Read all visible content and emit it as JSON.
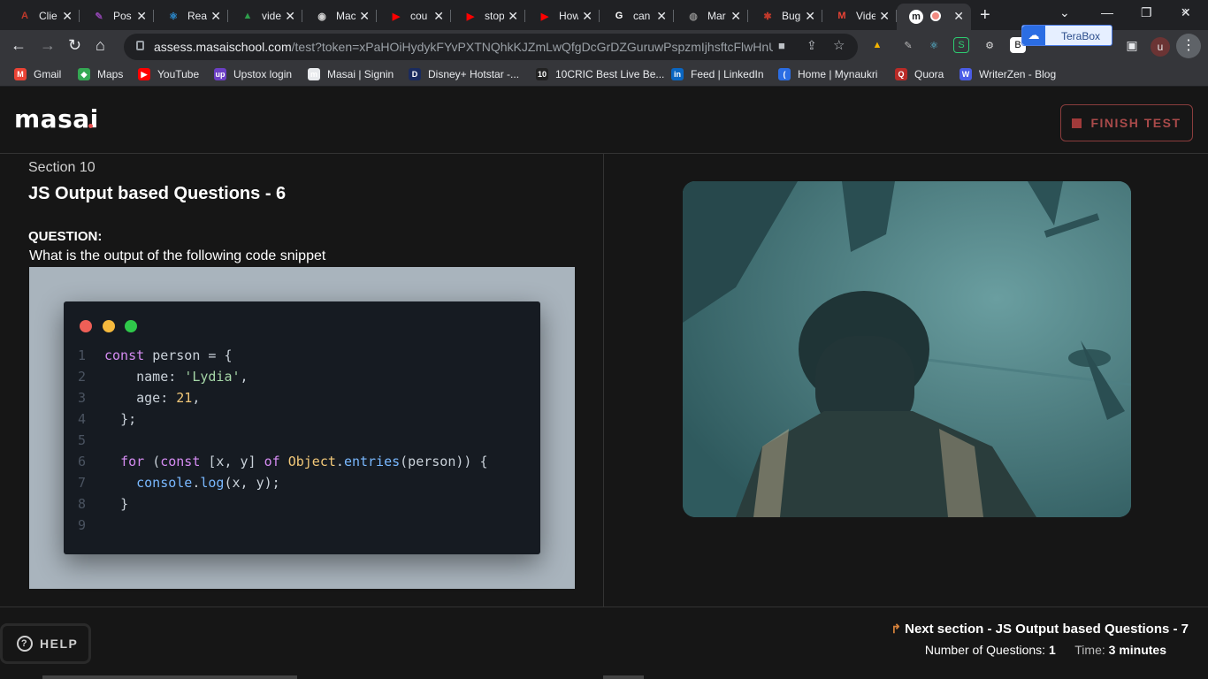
{
  "browser": {
    "tabs": [
      {
        "label": "Clie",
        "icon": "acrobat-icon",
        "color": "#c0392b",
        "glyph": "A"
      },
      {
        "label": "Pos",
        "icon": "pen-icon",
        "color": "#8e44ad",
        "glyph": "✎"
      },
      {
        "label": "Rea",
        "icon": "react-icon",
        "color": "#2b8fd6",
        "glyph": "⚛"
      },
      {
        "label": "vide",
        "icon": "drive-icon",
        "color": "#2e9e4b",
        "glyph": "▲"
      },
      {
        "label": "Mac",
        "icon": "ball-icon",
        "color": "#d0d0d0",
        "glyph": "◉"
      },
      {
        "label": "cou",
        "icon": "youtube-icon",
        "color": "#ff0000",
        "glyph": "▶"
      },
      {
        "label": "stop",
        "icon": "youtube-icon",
        "color": "#ff0000",
        "glyph": "▶"
      },
      {
        "label": "How",
        "icon": "youtube-icon",
        "color": "#ff0000",
        "glyph": "▶"
      },
      {
        "label": "can",
        "icon": "google-icon",
        "color": "#ffffff",
        "glyph": "G"
      },
      {
        "label": "Mar",
        "icon": "globe-icon",
        "color": "#888888",
        "glyph": "◍"
      },
      {
        "label": "Bug",
        "icon": "bug-icon",
        "color": "#c0392b",
        "glyph": "✱"
      },
      {
        "label": "Vide",
        "icon": "gmail-icon",
        "color": "#ea4335",
        "glyph": "M"
      },
      {
        "label": "",
        "icon": "masai-icon",
        "color": "#ffffff",
        "glyph": "m",
        "active": true
      }
    ],
    "close_glyph": "✕",
    "new_tab_glyph": "+",
    "url_host": "assess.masaischool.com",
    "url_path": "/test?token=xPaHOiHydykFYvPXTNQhkKJZmLwQfgDcGrDZGuruwPspzmIjhsftcFlwHnUf...",
    "extension_label": "TeraBox",
    "profile_initial": "u",
    "bookmarks": [
      {
        "label": "Gmail",
        "icon": "gmail-icon",
        "color": "#ea4335",
        "glyph": "M"
      },
      {
        "label": "Maps",
        "icon": "maps-icon",
        "color": "#34a853",
        "glyph": "◆"
      },
      {
        "label": "YouTube",
        "icon": "youtube-icon",
        "color": "#ff0000",
        "glyph": "▶"
      },
      {
        "label": "Upstox login",
        "icon": "upstox-icon",
        "color": "#6c3fc5",
        "glyph": "up"
      },
      {
        "label": "Masai | Signin",
        "icon": "masai-icon",
        "color": "#e8eaed",
        "glyph": "m"
      },
      {
        "label": "Disney+ Hotstar -...",
        "icon": "hotstar-icon",
        "color": "#1a2b5e",
        "glyph": "D"
      },
      {
        "label": "10CRIC Best Live Be...",
        "icon": "cric-icon",
        "color": "#222222",
        "glyph": "10"
      },
      {
        "label": "Feed | LinkedIn",
        "icon": "linkedin-icon",
        "color": "#0a66c2",
        "glyph": "in"
      },
      {
        "label": "Home | Mynaukri",
        "icon": "naukri-icon",
        "color": "#2b6de3",
        "glyph": "("
      },
      {
        "label": "Quora",
        "icon": "quora-icon",
        "color": "#b92b27",
        "glyph": "Q"
      },
      {
        "label": "WriterZen - Blog",
        "icon": "writerzen-icon",
        "color": "#4a5ce6",
        "glyph": "W"
      }
    ]
  },
  "header": {
    "logo": "masai",
    "finish_label": "FINISH TEST"
  },
  "question": {
    "section": "Section 10",
    "title": "JS Output based Questions - 6",
    "label": "QUESTION:",
    "text": "What is the output of the following code snippet"
  },
  "code": {
    "line_numbers": [
      "1",
      "2",
      "3",
      "4",
      "5",
      "6",
      "7",
      "8",
      "9"
    ]
  },
  "footer": {
    "help_label": "HELP",
    "next_section": "Next section - JS Output based Questions - 7",
    "num_questions_label": "Number of Questions:",
    "num_questions": "1",
    "time_label": "Time:",
    "time_value": "3 minutes"
  },
  "colors": {
    "accent_finish": "#a94a4a",
    "code_bg": "#161b22",
    "snippet_bg": "#a9b4bd"
  }
}
